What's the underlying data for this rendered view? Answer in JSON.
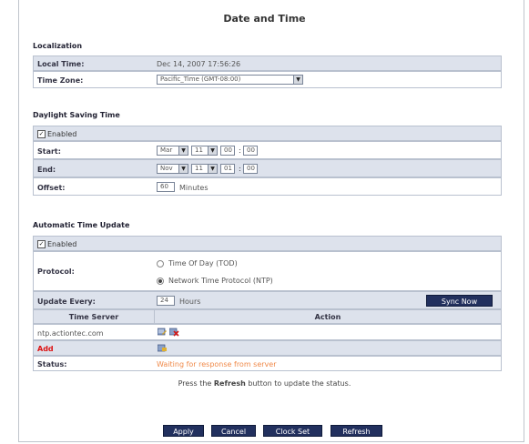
{
  "page": {
    "title": "Date and Time"
  },
  "localization": {
    "heading": "Localization",
    "local_time_label": "Local Time:",
    "local_time_value": "Dec 14, 2007 17:56:26",
    "time_zone_label": "Time Zone:",
    "time_zone_value": "Pacific_Time (GMT-08:00)"
  },
  "dst": {
    "heading": "Daylight Saving Time",
    "enabled_label": "Enabled",
    "start_label": "Start:",
    "start_month": "Mar",
    "start_day": "11",
    "start_hour": "00",
    "start_min": "00",
    "end_label": "End:",
    "end_month": "Nov",
    "end_day": "11",
    "end_hour": "01",
    "end_min": "00",
    "offset_label": "Offset:",
    "offset_value": "60",
    "offset_unit": "Minutes",
    "colon": ":"
  },
  "auto": {
    "heading": "Automatic Time Update",
    "enabled_label": "Enabled",
    "protocol_label": "Protocol:",
    "protocol_tod": "Time Of Day (TOD)",
    "protocol_ntp": "Network Time Protocol (NTP)",
    "update_label": "Update Every:",
    "update_value": "24",
    "update_unit": "Hours",
    "sync_button": "Sync Now",
    "col_server": "Time Server",
    "col_action": "Action",
    "server_name": "ntp.actiontec.com",
    "add_label": "Add",
    "status_label": "Status:",
    "status_value": "Waiting for response from server"
  },
  "hint": {
    "pre": "Press the ",
    "bold": "Refresh",
    "post": " button to update the status."
  },
  "buttons": {
    "apply": "Apply",
    "cancel": "Cancel",
    "clock_set": "Clock Set",
    "refresh": "Refresh"
  }
}
